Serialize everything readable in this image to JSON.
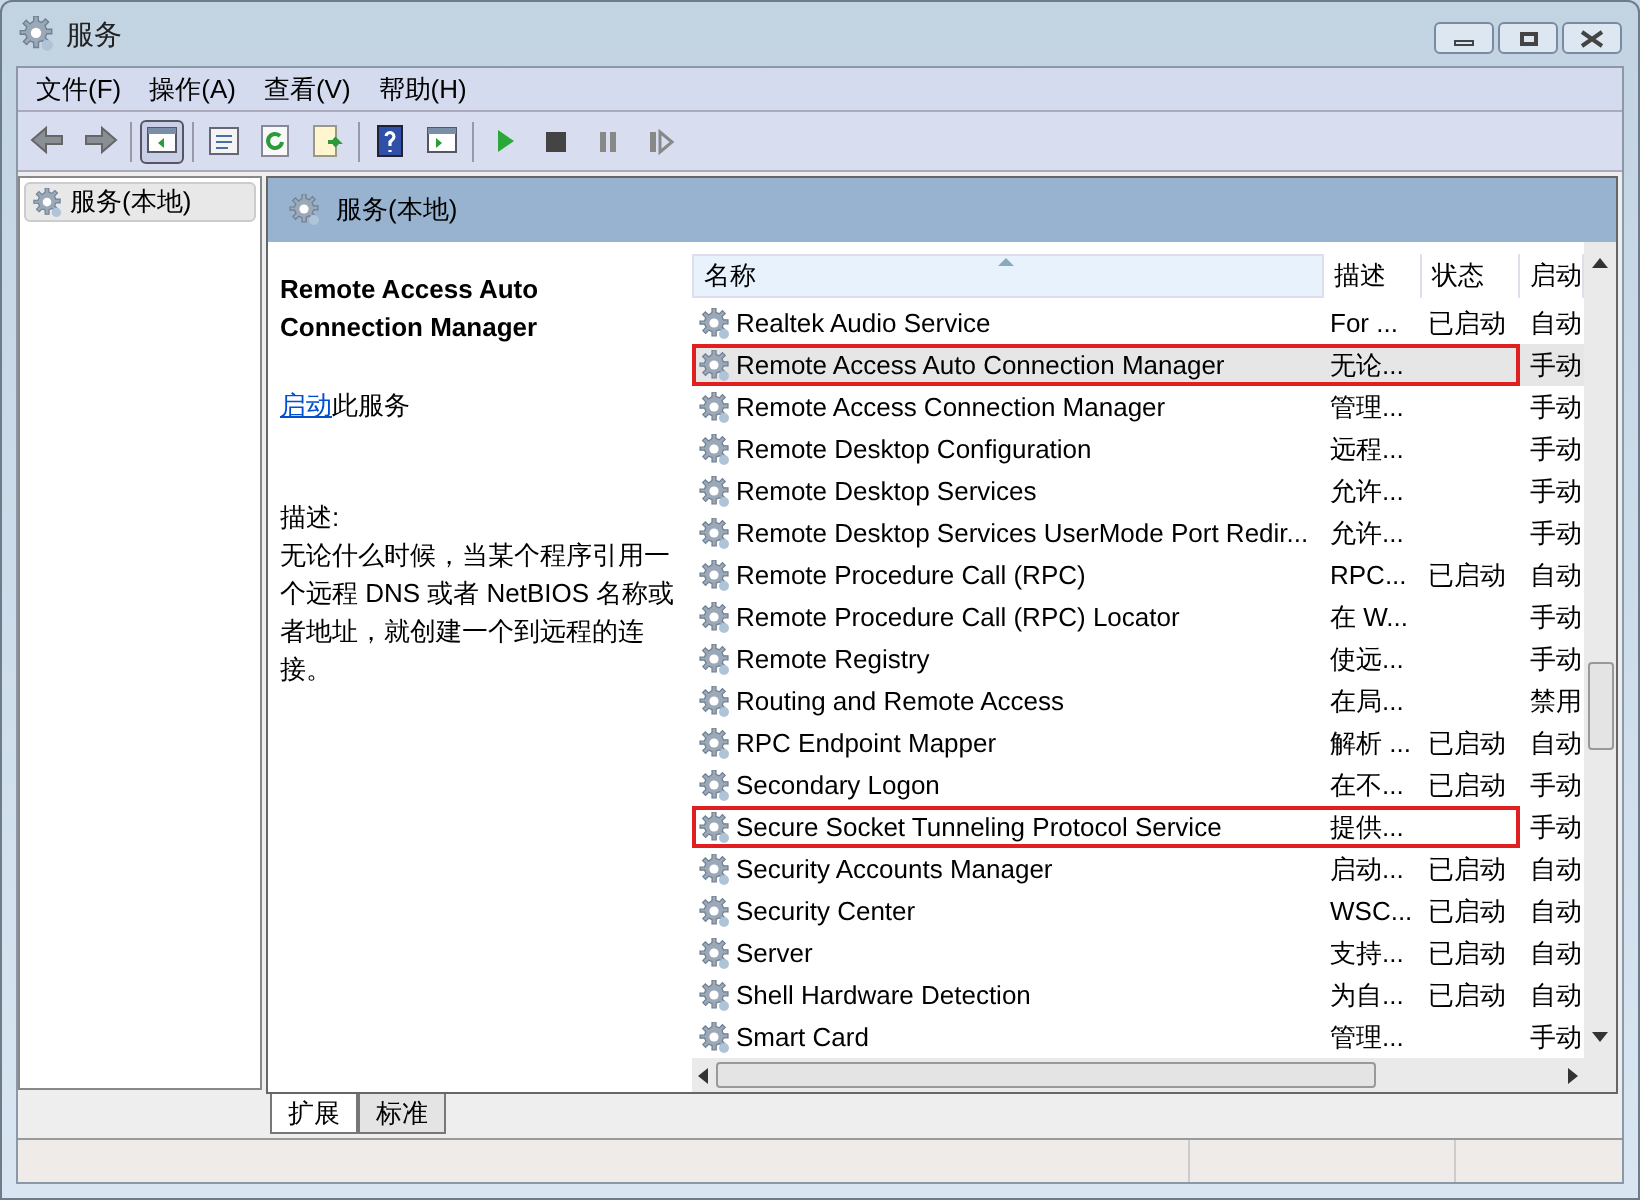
{
  "window": {
    "title": "服务"
  },
  "menu": [
    "文件(F)",
    "操作(A)",
    "查看(V)",
    "帮助(H)"
  ],
  "tree": {
    "items": [
      {
        "label": "服务(本地)",
        "selected": true
      }
    ]
  },
  "panel": {
    "title": "服务(本地)"
  },
  "details": {
    "service_name": "Remote Access Auto Connection Manager",
    "action_link": "启动",
    "action_text": "此服务",
    "description_label": "描述:",
    "description": "无论什么时候，当某个程序引用一个远程 DNS 或者 NetBIOS 名称或者地址，就创建一个到远程的连接。"
  },
  "table": {
    "columns": [
      "名称",
      "描述",
      "状态",
      "启动"
    ],
    "rows": [
      {
        "name": "Realtek Audio Service",
        "description": "For ...",
        "status": "已启动",
        "startup": "自动",
        "selected": false,
        "marked": false
      },
      {
        "name": "Remote Access Auto Connection Manager",
        "description": "无论...",
        "status": "",
        "startup": "手动",
        "selected": true,
        "marked": true
      },
      {
        "name": "Remote Access Connection Manager",
        "description": "管理...",
        "status": "",
        "startup": "手动",
        "selected": false,
        "marked": false
      },
      {
        "name": "Remote Desktop Configuration",
        "description": "远程...",
        "status": "",
        "startup": "手动",
        "selected": false,
        "marked": false
      },
      {
        "name": "Remote Desktop Services",
        "description": "允许...",
        "status": "",
        "startup": "手动",
        "selected": false,
        "marked": false
      },
      {
        "name": "Remote Desktop Services UserMode Port Redir...",
        "description": "允许...",
        "status": "",
        "startup": "手动",
        "selected": false,
        "marked": false
      },
      {
        "name": "Remote Procedure Call (RPC)",
        "description": "RPC...",
        "status": "已启动",
        "startup": "自动",
        "selected": false,
        "marked": false
      },
      {
        "name": "Remote Procedure Call (RPC) Locator",
        "description": "在 W...",
        "status": "",
        "startup": "手动",
        "selected": false,
        "marked": false
      },
      {
        "name": "Remote Registry",
        "description": "使远...",
        "status": "",
        "startup": "手动",
        "selected": false,
        "marked": false
      },
      {
        "name": "Routing and Remote Access",
        "description": "在局...",
        "status": "",
        "startup": "禁用",
        "selected": false,
        "marked": false
      },
      {
        "name": "RPC Endpoint Mapper",
        "description": "解析 ...",
        "status": "已启动",
        "startup": "自动",
        "selected": false,
        "marked": false
      },
      {
        "name": "Secondary Logon",
        "description": "在不...",
        "status": "已启动",
        "startup": "手动",
        "selected": false,
        "marked": false
      },
      {
        "name": "Secure Socket Tunneling Protocol Service",
        "description": "提供...",
        "status": "",
        "startup": "手动",
        "selected": false,
        "marked": true
      },
      {
        "name": "Security Accounts Manager",
        "description": "启动...",
        "status": "已启动",
        "startup": "自动",
        "selected": false,
        "marked": false
      },
      {
        "name": "Security Center",
        "description": "WSC...",
        "status": "已启动",
        "startup": "自动",
        "selected": false,
        "marked": false
      },
      {
        "name": "Server",
        "description": "支持...",
        "status": "已启动",
        "startup": "自动",
        "selected": false,
        "marked": false
      },
      {
        "name": "Shell Hardware Detection",
        "description": "为自...",
        "status": "已启动",
        "startup": "自动",
        "selected": false,
        "marked": false
      },
      {
        "name": "Smart Card",
        "description": "管理...",
        "status": "",
        "startup": "手动",
        "selected": false,
        "marked": false
      }
    ]
  },
  "tabs": [
    {
      "label": "扩展",
      "selected": true
    },
    {
      "label": "标准",
      "selected": false
    }
  ]
}
